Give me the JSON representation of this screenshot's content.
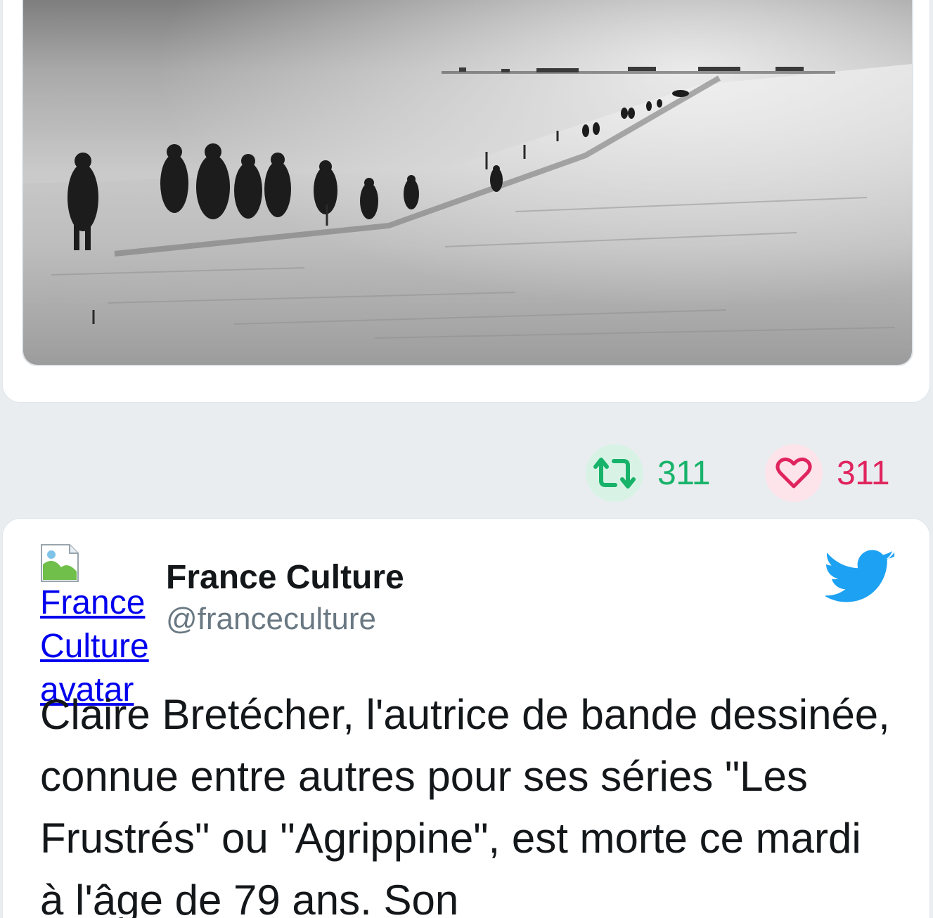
{
  "colors": {
    "background": "#e9edf0",
    "retweet_green": "#18b36a",
    "like_red": "#e0245e",
    "twitter_blue": "#1da1f2",
    "handle_gray": "#697882"
  },
  "top_tweet": {
    "media_description_icon": "photo-icon",
    "actions": {
      "retweet_count": "311",
      "like_count": "311",
      "retweet_icon": "retweet-icon",
      "like_icon": "heart-icon"
    }
  },
  "tweet": {
    "avatar_alt": "France Culture avatar",
    "author_name": "France Culture",
    "author_handle": "@franceculture",
    "brand_icon": "twitter-bird-icon",
    "text": "Claire Bretécher, l'autrice de bande dessinée, connue entre autres pour ses séries \"Les Frustrés\" ou \"Agrippine\", est morte ce mardi à l'âge de 79 ans. Son"
  }
}
